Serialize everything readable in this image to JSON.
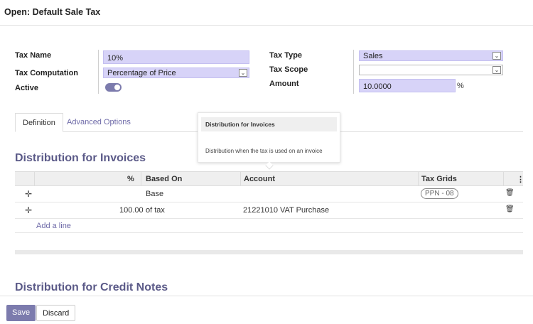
{
  "header": {
    "title": "Open: Default Sale Tax"
  },
  "form": {
    "tax_name": {
      "label": "Tax Name",
      "value": "10%"
    },
    "tax_computation": {
      "label": "Tax Computation",
      "value": "Percentage of Price"
    },
    "active": {
      "label": "Active",
      "on": true
    },
    "tax_type": {
      "label": "Tax Type",
      "value": "Sales"
    },
    "tax_scope": {
      "label": "Tax Scope",
      "value": ""
    },
    "amount": {
      "label": "Amount",
      "value": "10.0000",
      "unit": "%"
    }
  },
  "tabs": [
    {
      "label": "Definition",
      "active": true
    },
    {
      "label": "Advanced Options",
      "active": false
    }
  ],
  "tooltip": {
    "title": "Distribution for Invoices",
    "body": "Distribution when the tax is used on an invoice"
  },
  "invoices": {
    "title": "Distribution for Invoices",
    "columns": {
      "percent": "%",
      "based_on": "Based On",
      "account": "Account",
      "tax_grids": "Tax Grids"
    },
    "rows": [
      {
        "percent": "",
        "based_on": "Base",
        "account": "",
        "tax_grid": "PPN - 08"
      },
      {
        "percent": "100.00",
        "based_on": "of tax",
        "account": "21221010 VAT Purchase",
        "tax_grid": ""
      }
    ],
    "add_line": "Add a line"
  },
  "credit_notes": {
    "title": "Distribution for Credit Notes"
  },
  "footer": {
    "save": "Save",
    "discard": "Discard"
  },
  "colors": {
    "accent": "#7c7bad",
    "field_bg": "#d7d3f8",
    "section_title": "#5b5a88"
  }
}
